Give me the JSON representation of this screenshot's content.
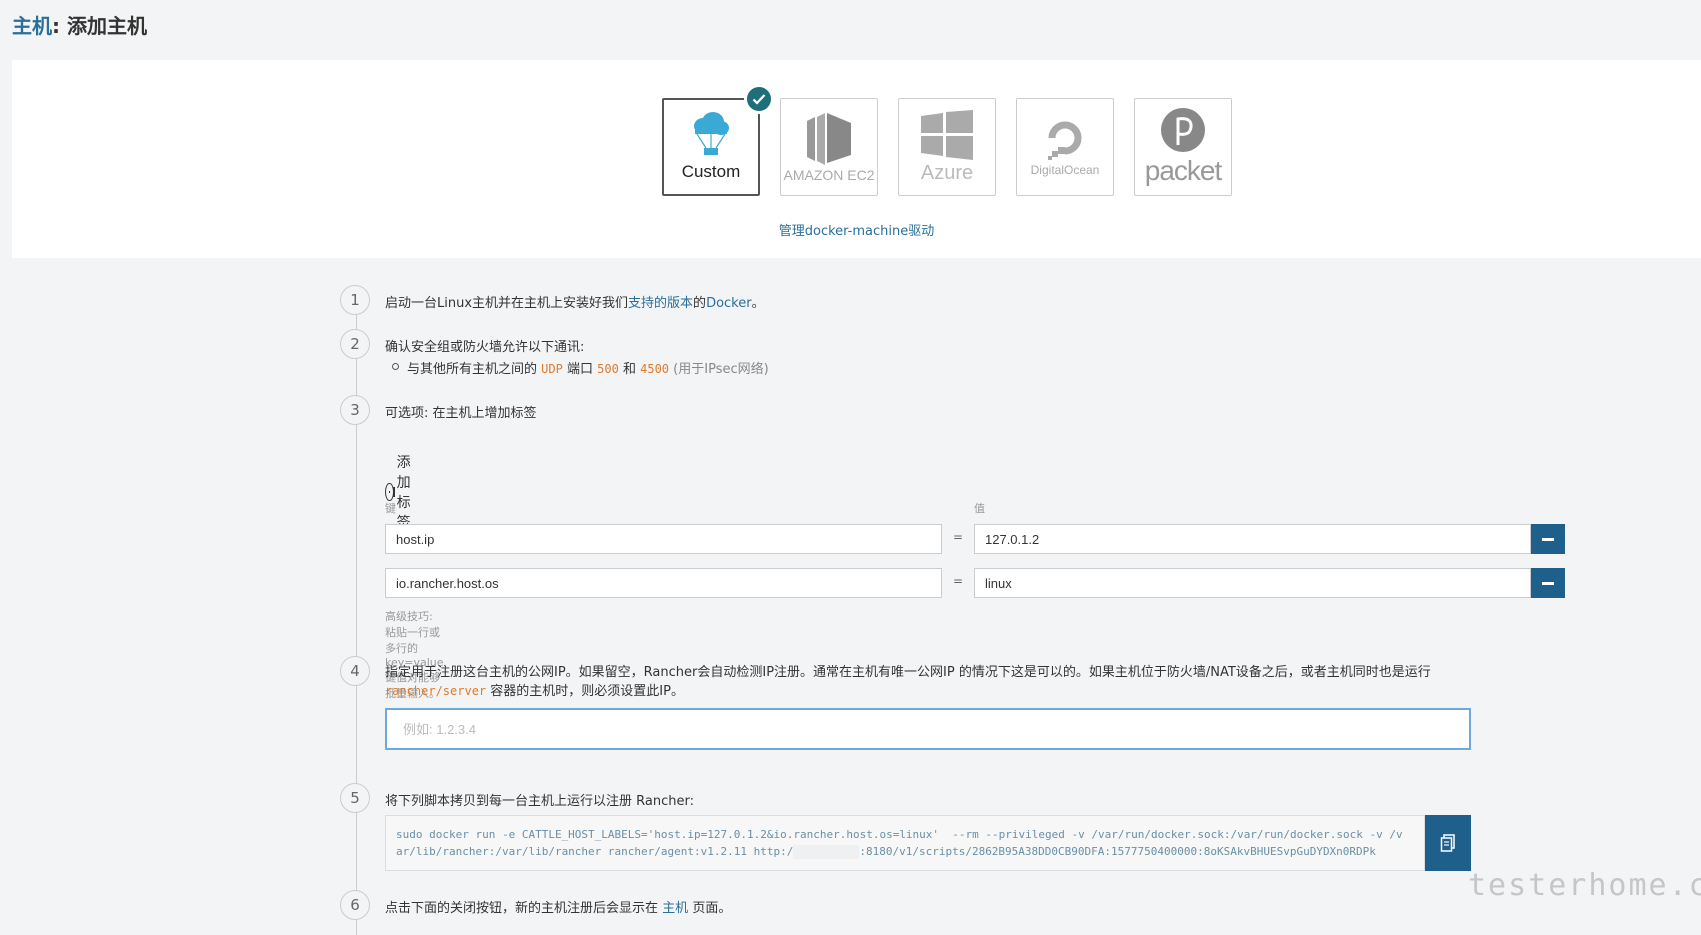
{
  "header": {
    "crumb": "主机",
    "separator": ": ",
    "title": "添加主机"
  },
  "drivers": {
    "items": [
      {
        "name": "custom",
        "label": "Custom",
        "selected": true
      },
      {
        "name": "amazon-ec2",
        "label": "AMAZON EC2"
      },
      {
        "name": "azure",
        "label": "Azure"
      },
      {
        "name": "digitalocean",
        "label": "DigitalOcean"
      },
      {
        "name": "packet",
        "label": "packet"
      }
    ],
    "manage_link": "管理docker-machine驱动"
  },
  "steps": {
    "s1": {
      "num": "1",
      "text_before": "启动一台Linux主机并在主机上安装好我们",
      "link": "支持的版本",
      "text_mid": "的",
      "link2": "Docker",
      "text_after": "。"
    },
    "s2": {
      "num": "2",
      "text": "确认安全组或防火墙允许以下通讯:",
      "bullet": {
        "prefix": "与其他所有主机之间的",
        "proto": "UDP",
        "port_word": "端口",
        "port1": "500",
        "and": "和",
        "port2": "4500",
        "note": "(用于IPsec网络)"
      }
    },
    "s3": {
      "num": "3",
      "text": "可选项: 在主机上增加标签"
    },
    "s4": {
      "num": "4",
      "line1": "指定用于注册这台主机的公网IP。如果留空，Rancher会自动检测IP注册。通常在主机有唯一公网IP 的情况下这是可以的。如果主机位于防火墙/NAT设备之后，或者主机同时也是运行",
      "code": "rancher/server",
      "line2_after": "容器的主机时，则必须设置此IP。"
    },
    "s5": {
      "num": "5",
      "text": "将下列脚本拷贝到每一台主机上运行以注册 Rancher:"
    },
    "s6": {
      "num": "6",
      "text_before": "点击下面的关闭按钮，新的主机注册后会显示在",
      "link": "主机",
      "text_after": "页面。"
    }
  },
  "labels": {
    "add_label": "添加标签",
    "key_header": "键",
    "value_header": "值",
    "equals": "=",
    "rows": [
      {
        "key": "host.ip",
        "value": "127.0.1.2"
      },
      {
        "key": "io.rancher.host.os",
        "value": "linux"
      }
    ],
    "hint": "高级技巧: 粘贴一行或多行的 key=value键值对能够批量输入。"
  },
  "ip_input": {
    "placeholder": "例如: 1.2.3.4",
    "value": ""
  },
  "script": {
    "line1": "sudo docker run -e CATTLE_HOST_LABELS='host.ip=127.0.1.2&io.rancher.host.os=linux'  --rm --privileged -v /var/run/docker.sock:/var/run/docker.sock -v /v",
    "line2_a": "ar/lib/rancher:/var/lib/rancher rancher/agent:v1.2.11 http:/",
    "line2_b": ":8180/v1/scripts/2862B95A38DD0CB90DFA:1577750400000:8oKSAkvBHUESvpGuDYDXn0RDPk"
  },
  "watermark": "testerhome.com",
  "colors": {
    "accent": "#1f5f8b",
    "link": "#2a6f9a",
    "code": "#e07b2a",
    "check": "#1f6f7a"
  }
}
